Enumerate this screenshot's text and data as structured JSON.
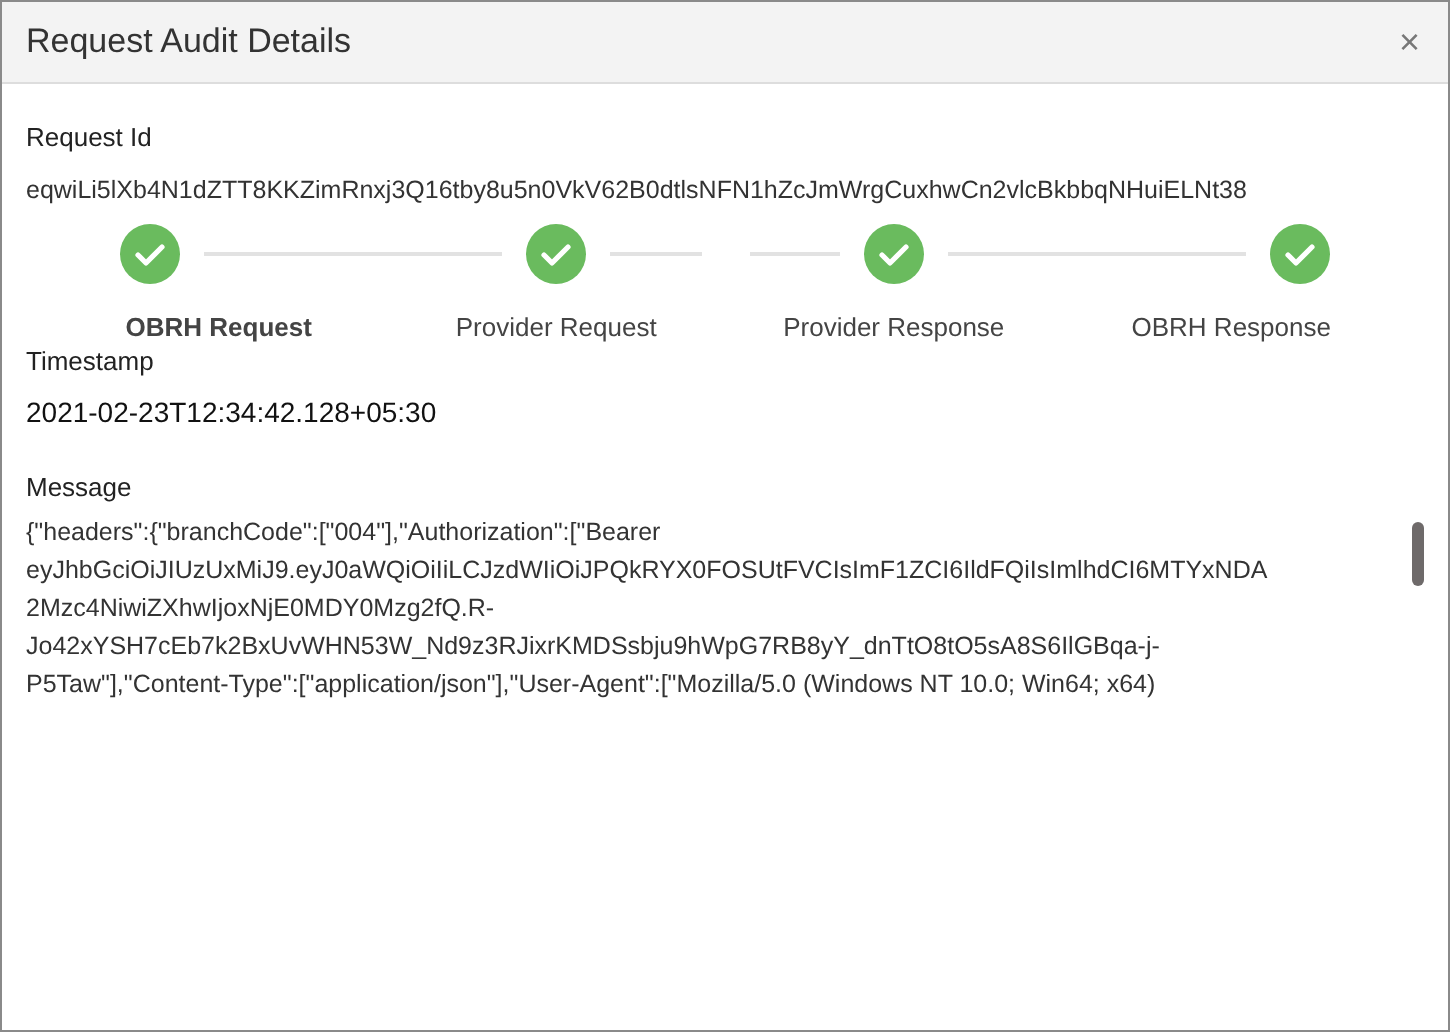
{
  "dialog": {
    "title": "Request Audit Details",
    "close": "×"
  },
  "request_id": {
    "label": "Request Id",
    "value": "eqwiLi5lXb4N1dZTT8KKZimRnxj3Q16tby8u5n0VkV62B0dtlsNFN1hZcJmWrgCuxhwCn2vlcBkbbqNHuiELNt38"
  },
  "steps": [
    {
      "label": "OBRH Request",
      "done": true,
      "selected": true
    },
    {
      "label": "Provider Request",
      "done": true,
      "selected": false
    },
    {
      "label": "Provider Response",
      "done": true,
      "selected": false
    },
    {
      "label": "OBRH Response",
      "done": true,
      "selected": false
    }
  ],
  "timestamp": {
    "label": "Timestamp",
    "value": "2021-02-23T12:34:42.128+05:30"
  },
  "message": {
    "label": "Message",
    "lines": [
      "{\"headers\":{\"branchCode\":[\"004\"],\"Authorization\":[\"Bearer",
      "eyJhbGciOiJIUzUxMiJ9.eyJ0aWQiOiIiLCJzdWIiOiJPQkRYX0FOSUtFVCIsImF1ZCI6IldFQiIsImlhdCI6MTYxNDA",
      "2Mzc4NiwiZXhwIjoxNjE0MDY0Mzg2fQ.R-",
      "Jo42xYSH7cEb7k2BxUvWHN53W_Nd9z3RJixrKMDSsbju9hWpG7RB8yY_dnTtO8tO5sA8S6IlGBqa-j-",
      "P5Taw\"],\"Content-Type\":[\"application/json\"],\"User-Agent\":[\"Mozilla/5.0 (Windows NT 10.0; Win64; x64)"
    ]
  }
}
